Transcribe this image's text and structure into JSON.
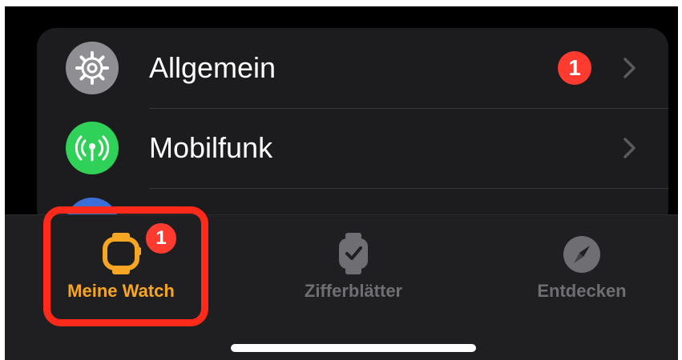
{
  "settings_rows": [
    {
      "label": "Allgemein",
      "icon": "gear-icon",
      "icon_bg": "#8e8e93",
      "badge": "1"
    },
    {
      "label": "Mobilfunk",
      "icon": "antenna-icon",
      "icon_bg": "#30d158",
      "badge": ""
    }
  ],
  "tabbar": {
    "tabs": [
      {
        "label": "Meine Watch",
        "icon": "watch-icon",
        "active": true,
        "badge": "1"
      },
      {
        "label": "Zifferblätter",
        "icon": "watch-face-icon",
        "active": false
      },
      {
        "label": "Entdecken",
        "icon": "compass-icon",
        "active": false
      }
    ]
  },
  "colors": {
    "active_tab": "#f6a623",
    "inactive_tab": "#6e6e73",
    "badge": "#ff3b30",
    "highlight_box": "#ff2a1a"
  }
}
